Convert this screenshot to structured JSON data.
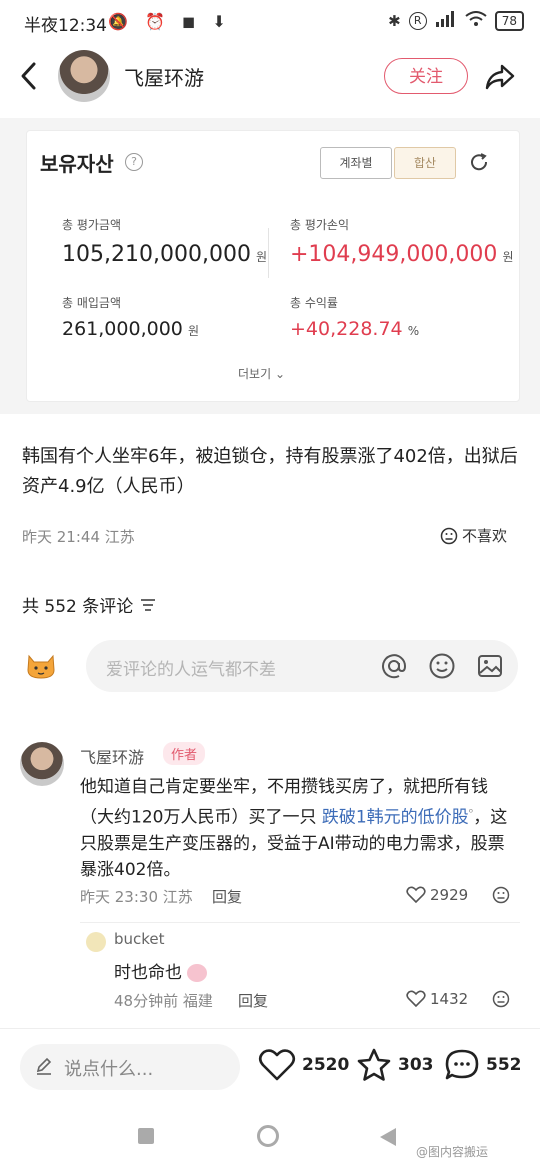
{
  "status_bar": {
    "time": "半夜12:34",
    "left_icons": "🔕 ⏰ ◼ ⬇",
    "right_text": "R",
    "battery": "78"
  },
  "header": {
    "author": "飞屋环游",
    "follow_label": "关注"
  },
  "embedded": {
    "title": "보유자산",
    "help": "?",
    "tab_account": "계좌별",
    "tab_sum": "합산",
    "total_eval_label": "총 평가금액",
    "total_eval_value": "105,210,000,000",
    "total_eval_unit": "원",
    "total_pl_label": "총 평가손익",
    "total_pl_value": "+104,949,000,000",
    "total_pl_unit": "원",
    "total_buy_label": "총 매입금액",
    "total_buy_value": "261,000,000",
    "total_buy_unit": "원",
    "return_label": "총 수익률",
    "return_value": "+40,228.74",
    "return_unit": "%",
    "more": "더보기"
  },
  "post": {
    "text": "韩国有个人坐牢6年，被迫锁仓，持有股票涨了402倍，出狱后资产4.9亿（人民币）",
    "meta": "昨天 21:44 江苏",
    "dislike_label": "不喜欢"
  },
  "comments_header": {
    "count_label": "共 552 条评论"
  },
  "comment_input": {
    "placeholder": "爱评论的人运气都不差"
  },
  "comment1": {
    "author": "飞屋环游",
    "badge": "作者",
    "text_before": "他知道自己肯定要坐牢，不用攒钱买房了，就把所有钱（大约120万人民币）买了一只 ",
    "link": "跌破1韩元的低价股",
    "text_after": "，这只股票是生产变压器的，受益于AI带动的电力需求，股票暴涨402倍。",
    "meta": "昨天 23:30 江苏",
    "reply": "回复",
    "likes": "2929"
  },
  "reply1": {
    "author": "bucket",
    "text": "时也命也",
    "meta": "48分钟前 福建",
    "reply": "回复",
    "likes": "1432"
  },
  "bottom_bar": {
    "placeholder": "说点什么...",
    "likes": "2520",
    "stars": "303",
    "comments": "552"
  },
  "watermark": "@图内容搬运"
}
